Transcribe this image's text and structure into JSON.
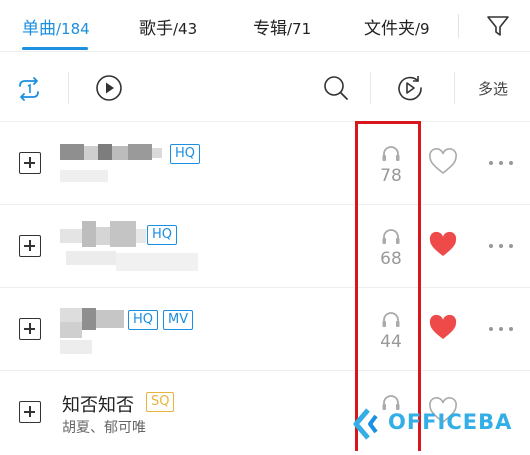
{
  "tabs": [
    {
      "label": "单曲",
      "count": "/184",
      "active": true
    },
    {
      "label": "歌手",
      "count": "/43",
      "active": false
    },
    {
      "label": "专辑",
      "count": "/71",
      "active": false
    },
    {
      "label": "文件夹",
      "count": "/9",
      "active": false
    }
  ],
  "toolbar": {
    "multi_select_label": "多选",
    "icons": [
      "repeat-one-icon",
      "play-icon",
      "search-icon",
      "playlist-play-icon"
    ]
  },
  "songs": [
    {
      "title": "",
      "artist": "",
      "badges": [
        "HQ"
      ],
      "listen_count": "78",
      "favorited": false
    },
    {
      "title": "",
      "artist": "",
      "badges": [
        "HQ"
      ],
      "listen_count": "68",
      "favorited": true
    },
    {
      "title": "",
      "artist": "",
      "badges": [
        "HQ",
        "MV"
      ],
      "listen_count": "44",
      "favorited": true
    },
    {
      "title": "知否知否",
      "artist": "胡夏、郁可唯",
      "badges": [
        "SQ"
      ],
      "listen_count": "",
      "favorited": false
    }
  ],
  "watermark": {
    "text": "OFFICEBA"
  },
  "colors": {
    "accent": "#1b8fe0",
    "heart": "#ef4a4a",
    "highlight": "#d8161d",
    "sq": "#e8b53a"
  }
}
